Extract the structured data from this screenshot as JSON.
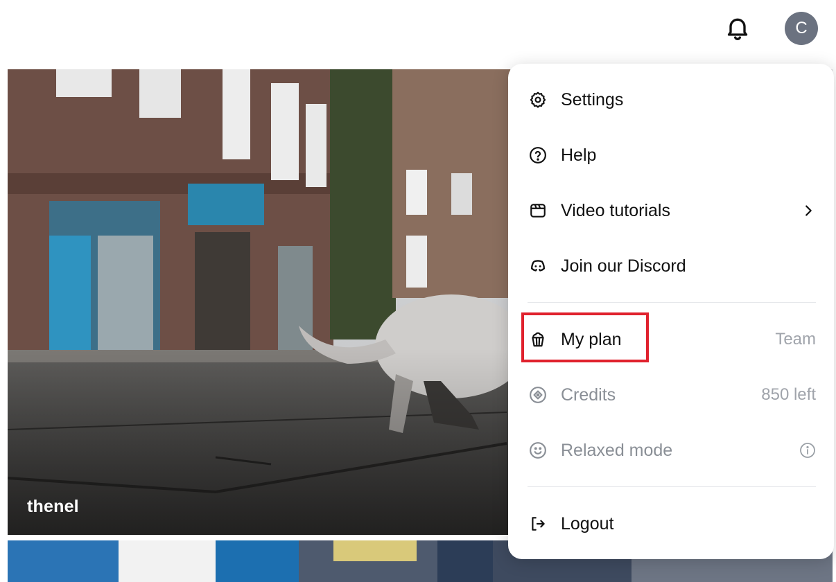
{
  "header": {
    "avatar_initial": "C",
    "icons": {
      "bell": "bell-icon"
    }
  },
  "card": {
    "label": "thenel"
  },
  "menu": {
    "items": [
      {
        "label": "Settings",
        "icon": "gear-icon"
      },
      {
        "label": "Help",
        "icon": "help-circle-icon"
      },
      {
        "label": "Video tutorials",
        "icon": "clapperboard-icon",
        "has_submenu": true
      },
      {
        "label": "Join our Discord",
        "icon": "discord-icon"
      },
      {
        "label": "My plan",
        "icon": "popcorn-icon",
        "value": "Team"
      },
      {
        "label": "Credits",
        "icon": "coin-icon",
        "value": "850 left"
      },
      {
        "label": "Relaxed mode",
        "icon": "smiley-icon"
      },
      {
        "label": "Logout",
        "icon": "logout-icon"
      }
    ]
  },
  "colors": {
    "highlight": "#e0212d",
    "avatar_bg": "#6b7280",
    "muted_text": "#a0a4ab"
  }
}
